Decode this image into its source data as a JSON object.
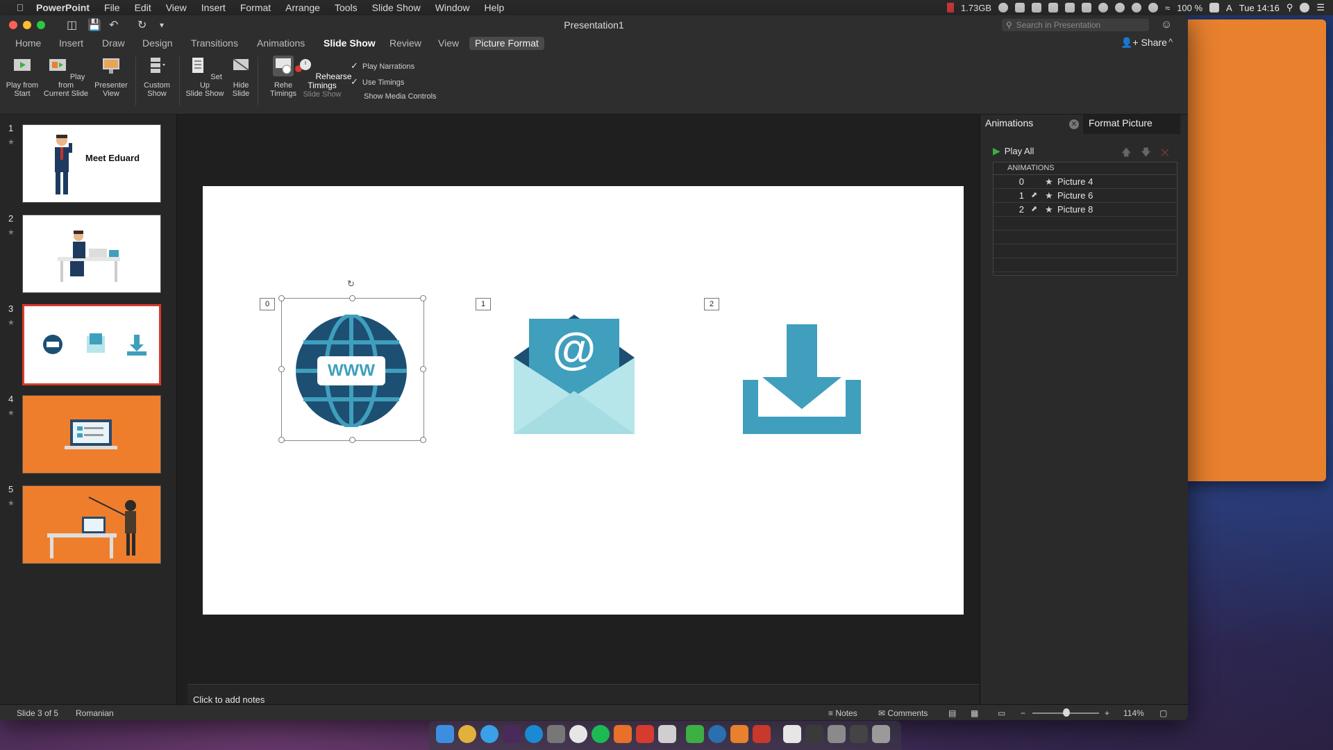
{
  "menubar": {
    "app": "PowerPoint",
    "items": [
      "File",
      "Edit",
      "View",
      "Insert",
      "Format",
      "Arrange",
      "Tools",
      "Slide Show",
      "Window",
      "Help"
    ],
    "memory": "1.73GB",
    "battery": "100 %",
    "clock": "Tue 14:16",
    "input_source": "A"
  },
  "window": {
    "title": "Presentation1",
    "search_placeholder": "Search in Presentation"
  },
  "tabs": [
    "Home",
    "Insert",
    "Draw",
    "Design",
    "Transitions",
    "Animations",
    "Slide Show",
    "Review",
    "View",
    "Picture Format"
  ],
  "share_label": "Share",
  "ribbon": {
    "play_from_start": [
      "Play from",
      "Start"
    ],
    "play_from_current": [
      "Play from",
      "Current Slide"
    ],
    "presenter_view": [
      "Presenter",
      "View"
    ],
    "custom_show": [
      "Custom",
      "Show"
    ],
    "set_up": [
      "Set Up",
      "Slide Show"
    ],
    "hide_slide": [
      "Hide",
      "Slide"
    ],
    "rehearse": [
      "Rehe",
      "Timings"
    ],
    "record": [
      "Rehearse Timings",
      "Slide Show"
    ],
    "play_narrations": "Play Narrations",
    "use_timings": "Use Timings",
    "show_media_controls": "Show Media Controls"
  },
  "slides": [
    {
      "num": "1",
      "title": "Meet Eduard"
    },
    {
      "num": "2"
    },
    {
      "num": "3"
    },
    {
      "num": "4"
    },
    {
      "num": "5"
    }
  ],
  "slide_canvas": {
    "tags": [
      "0",
      "1",
      "2"
    ],
    "globe_text": "WWW",
    "envelope_text": "@"
  },
  "notes_placeholder": "Click to add notes",
  "animations_pane": {
    "tab_active": "Animations",
    "tab_other": "Format Picture",
    "play_all": "Play All",
    "header": "ANIMATIONS",
    "rows": [
      {
        "n": "0",
        "name": "Picture 4"
      },
      {
        "n": "1",
        "name": "Picture 6"
      },
      {
        "n": "2",
        "name": "Picture 8"
      }
    ]
  },
  "statusbar": {
    "slide_info": "Slide 3 of 5",
    "language": "Romanian",
    "notes": "Notes",
    "comments": "Comments",
    "zoom": "114%"
  },
  "colors": {
    "accent_red": "#d63b2e",
    "slide_orange": "#ef7e2c",
    "icon_teal": "#3f9fbd",
    "icon_dark_blue": "#1d4f73"
  }
}
